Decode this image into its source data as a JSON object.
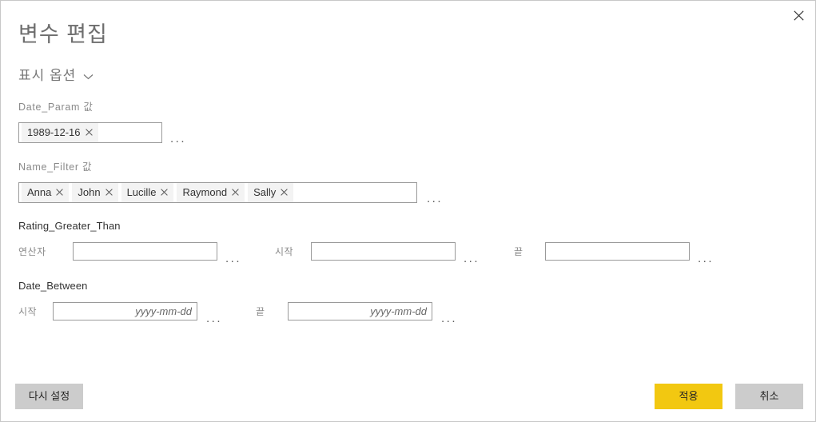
{
  "dialog": {
    "title": "변수 편집",
    "close_icon": "close-icon",
    "display_options": {
      "label": "표시 옵션",
      "chevron": "chevron-down-icon"
    }
  },
  "fields": {
    "date_param": {
      "label": "Date_Param 값",
      "tokens": [
        {
          "text": "1989-12-16"
        }
      ],
      "more_label": "..."
    },
    "name_filter": {
      "label": "Name_Filter 값",
      "tokens": [
        {
          "text": "Anna"
        },
        {
          "text": "John"
        },
        {
          "text": "Lucille"
        },
        {
          "text": "Raymond"
        },
        {
          "text": "Sally"
        }
      ],
      "more_label": "..."
    },
    "rating_greater_than": {
      "label": "Rating_Greater_Than",
      "operator": {
        "label": "연산자",
        "value": "",
        "placeholder": "",
        "more_label": "..."
      },
      "start": {
        "label": "시작",
        "value": "",
        "placeholder": "",
        "more_label": "..."
      },
      "end": {
        "label": "끝",
        "value": "",
        "placeholder": "",
        "more_label": "..."
      }
    },
    "date_between": {
      "label": "Date_Between",
      "start": {
        "label": "시작",
        "value": "",
        "placeholder": "yyyy-mm-dd",
        "more_label": "..."
      },
      "end": {
        "label": "끝",
        "value": "",
        "placeholder": "yyyy-mm-dd",
        "more_label": "..."
      }
    }
  },
  "footer": {
    "reset_label": "다시 설정",
    "apply_label": "적용",
    "cancel_label": "취소"
  },
  "colors": {
    "accent": "#f2c811",
    "secondary_button": "#cccccc",
    "border": "#9a9a9a",
    "dialog_border": "#c8c8c8",
    "token_bg": "#f3f3f3",
    "title_text": "#6e6e6e",
    "label_text": "#8a8a8a"
  }
}
